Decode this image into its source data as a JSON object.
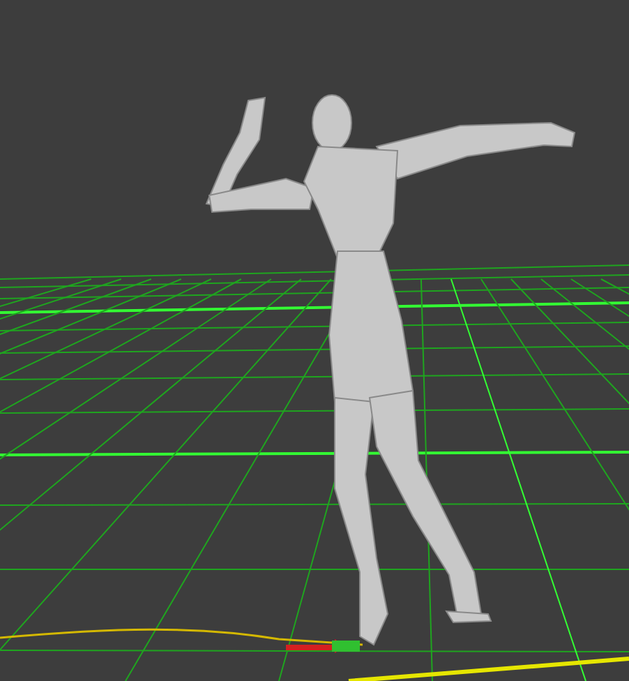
{
  "viewport": {
    "show_grid": true,
    "show_figure": true,
    "show_motion_path": true,
    "show_axis_gizmo": true
  }
}
